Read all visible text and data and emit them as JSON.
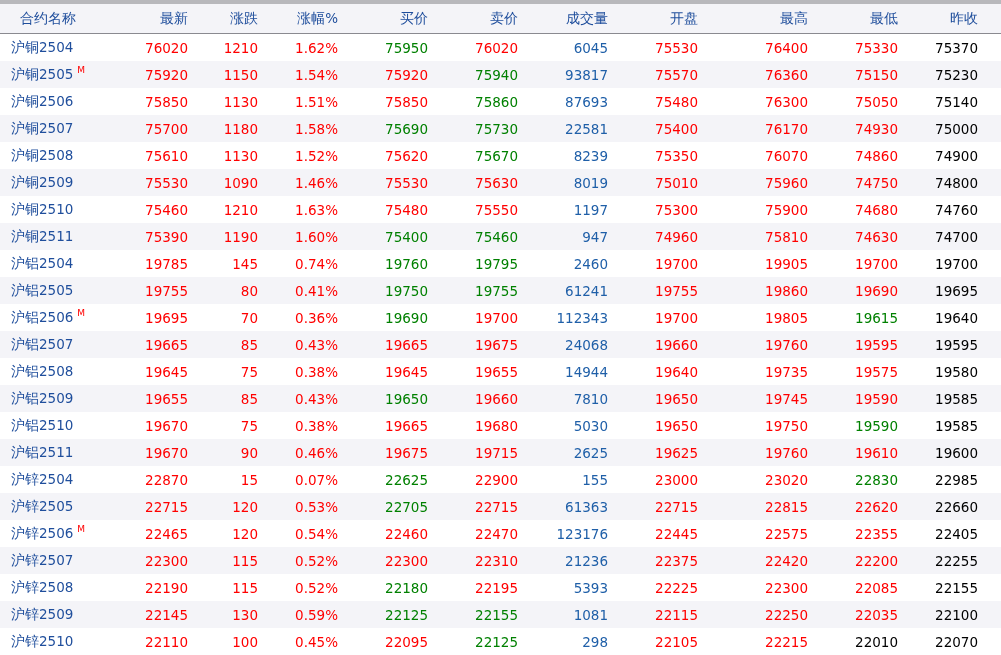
{
  "table": {
    "columns": [
      "合约名称",
      "最新",
      "涨跌",
      "涨幅%",
      "买价",
      "卖价",
      "成交量",
      "开盘",
      "最高",
      "最低",
      "昨收"
    ],
    "rows": [
      {
        "cells": [
          {
            "text": "沪铜2504",
            "color": "#1f4e9c"
          },
          {
            "text": "76020",
            "color": "#ff0000"
          },
          {
            "text": "1210",
            "color": "#ff0000"
          },
          {
            "text": "1.62%",
            "color": "#ff0000"
          },
          {
            "text": "75950",
            "color": "#008000"
          },
          {
            "text": "76020",
            "color": "#ff0000"
          },
          {
            "text": "6045",
            "color": "#1f5fa8"
          },
          {
            "text": "75530",
            "color": "#ff0000"
          },
          {
            "text": "76400",
            "color": "#ff0000"
          },
          {
            "text": "75330",
            "color": "#ff0000"
          },
          {
            "text": "75370",
            "color": "#000000"
          }
        ]
      },
      {
        "cells": [
          {
            "text": "沪铜2505",
            "marker": "M",
            "color": "#1f4e9c"
          },
          {
            "text": "75920",
            "color": "#ff0000"
          },
          {
            "text": "1150",
            "color": "#ff0000"
          },
          {
            "text": "1.54%",
            "color": "#ff0000"
          },
          {
            "text": "75920",
            "color": "#ff0000"
          },
          {
            "text": "75940",
            "color": "#008000"
          },
          {
            "text": "93817",
            "color": "#1f5fa8"
          },
          {
            "text": "75570",
            "color": "#ff0000"
          },
          {
            "text": "76360",
            "color": "#ff0000"
          },
          {
            "text": "75150",
            "color": "#ff0000"
          },
          {
            "text": "75230",
            "color": "#000000"
          }
        ]
      },
      {
        "cells": [
          {
            "text": "沪铜2506",
            "color": "#1f4e9c"
          },
          {
            "text": "75850",
            "color": "#ff0000"
          },
          {
            "text": "1130",
            "color": "#ff0000"
          },
          {
            "text": "1.51%",
            "color": "#ff0000"
          },
          {
            "text": "75850",
            "color": "#ff0000"
          },
          {
            "text": "75860",
            "color": "#008000"
          },
          {
            "text": "87693",
            "color": "#1f5fa8"
          },
          {
            "text": "75480",
            "color": "#ff0000"
          },
          {
            "text": "76300",
            "color": "#ff0000"
          },
          {
            "text": "75050",
            "color": "#ff0000"
          },
          {
            "text": "75140",
            "color": "#000000"
          }
        ]
      },
      {
        "cells": [
          {
            "text": "沪铜2507",
            "color": "#1f4e9c"
          },
          {
            "text": "75700",
            "color": "#ff0000"
          },
          {
            "text": "1180",
            "color": "#ff0000"
          },
          {
            "text": "1.58%",
            "color": "#ff0000"
          },
          {
            "text": "75690",
            "color": "#008000"
          },
          {
            "text": "75730",
            "color": "#008000"
          },
          {
            "text": "22581",
            "color": "#1f5fa8"
          },
          {
            "text": "75400",
            "color": "#ff0000"
          },
          {
            "text": "76170",
            "color": "#ff0000"
          },
          {
            "text": "74930",
            "color": "#ff0000"
          },
          {
            "text": "75000",
            "color": "#000000"
          }
        ]
      },
      {
        "cells": [
          {
            "text": "沪铜2508",
            "color": "#1f4e9c"
          },
          {
            "text": "75610",
            "color": "#ff0000"
          },
          {
            "text": "1130",
            "color": "#ff0000"
          },
          {
            "text": "1.52%",
            "color": "#ff0000"
          },
          {
            "text": "75620",
            "color": "#ff0000"
          },
          {
            "text": "75670",
            "color": "#008000"
          },
          {
            "text": "8239",
            "color": "#1f5fa8"
          },
          {
            "text": "75350",
            "color": "#ff0000"
          },
          {
            "text": "76070",
            "color": "#ff0000"
          },
          {
            "text": "74860",
            "color": "#ff0000"
          },
          {
            "text": "74900",
            "color": "#000000"
          }
        ]
      },
      {
        "cells": [
          {
            "text": "沪铜2509",
            "color": "#1f4e9c"
          },
          {
            "text": "75530",
            "color": "#ff0000"
          },
          {
            "text": "1090",
            "color": "#ff0000"
          },
          {
            "text": "1.46%",
            "color": "#ff0000"
          },
          {
            "text": "75530",
            "color": "#ff0000"
          },
          {
            "text": "75630",
            "color": "#ff0000"
          },
          {
            "text": "8019",
            "color": "#1f5fa8"
          },
          {
            "text": "75010",
            "color": "#ff0000"
          },
          {
            "text": "75960",
            "color": "#ff0000"
          },
          {
            "text": "74750",
            "color": "#ff0000"
          },
          {
            "text": "74800",
            "color": "#000000"
          }
        ]
      },
      {
        "cells": [
          {
            "text": "沪铜2510",
            "color": "#1f4e9c"
          },
          {
            "text": "75460",
            "color": "#ff0000"
          },
          {
            "text": "1210",
            "color": "#ff0000"
          },
          {
            "text": "1.63%",
            "color": "#ff0000"
          },
          {
            "text": "75480",
            "color": "#ff0000"
          },
          {
            "text": "75550",
            "color": "#ff0000"
          },
          {
            "text": "1197",
            "color": "#1f5fa8"
          },
          {
            "text": "75300",
            "color": "#ff0000"
          },
          {
            "text": "75900",
            "color": "#ff0000"
          },
          {
            "text": "74680",
            "color": "#ff0000"
          },
          {
            "text": "74760",
            "color": "#000000"
          }
        ]
      },
      {
        "cells": [
          {
            "text": "沪铜2511",
            "color": "#1f4e9c"
          },
          {
            "text": "75390",
            "color": "#ff0000"
          },
          {
            "text": "1190",
            "color": "#ff0000"
          },
          {
            "text": "1.60%",
            "color": "#ff0000"
          },
          {
            "text": "75400",
            "color": "#008000"
          },
          {
            "text": "75460",
            "color": "#008000"
          },
          {
            "text": "947",
            "color": "#1f5fa8"
          },
          {
            "text": "74960",
            "color": "#ff0000"
          },
          {
            "text": "75810",
            "color": "#ff0000"
          },
          {
            "text": "74630",
            "color": "#ff0000"
          },
          {
            "text": "74700",
            "color": "#000000"
          }
        ]
      },
      {
        "cells": [
          {
            "text": "沪铝2504",
            "color": "#1f4e9c"
          },
          {
            "text": "19785",
            "color": "#ff0000"
          },
          {
            "text": "145",
            "color": "#ff0000"
          },
          {
            "text": "0.74%",
            "color": "#ff0000"
          },
          {
            "text": "19760",
            "color": "#008000"
          },
          {
            "text": "19795",
            "color": "#008000"
          },
          {
            "text": "2460",
            "color": "#1f5fa8"
          },
          {
            "text": "19700",
            "color": "#ff0000"
          },
          {
            "text": "19905",
            "color": "#ff0000"
          },
          {
            "text": "19700",
            "color": "#ff0000"
          },
          {
            "text": "19700",
            "color": "#000000"
          }
        ]
      },
      {
        "cells": [
          {
            "text": "沪铝2505",
            "color": "#1f4e9c"
          },
          {
            "text": "19755",
            "color": "#ff0000"
          },
          {
            "text": "80",
            "color": "#ff0000"
          },
          {
            "text": "0.41%",
            "color": "#ff0000"
          },
          {
            "text": "19750",
            "color": "#008000"
          },
          {
            "text": "19755",
            "color": "#008000"
          },
          {
            "text": "61241",
            "color": "#1f5fa8"
          },
          {
            "text": "19755",
            "color": "#ff0000"
          },
          {
            "text": "19860",
            "color": "#ff0000"
          },
          {
            "text": "19690",
            "color": "#ff0000"
          },
          {
            "text": "19695",
            "color": "#000000"
          }
        ]
      },
      {
        "cells": [
          {
            "text": "沪铝2506",
            "marker": "M",
            "color": "#1f4e9c"
          },
          {
            "text": "19695",
            "color": "#ff0000"
          },
          {
            "text": "70",
            "color": "#ff0000"
          },
          {
            "text": "0.36%",
            "color": "#ff0000"
          },
          {
            "text": "19690",
            "color": "#008000"
          },
          {
            "text": "19700",
            "color": "#ff0000"
          },
          {
            "text": "112343",
            "color": "#1f5fa8"
          },
          {
            "text": "19700",
            "color": "#ff0000"
          },
          {
            "text": "19805",
            "color": "#ff0000"
          },
          {
            "text": "19615",
            "color": "#008000"
          },
          {
            "text": "19640",
            "color": "#000000"
          }
        ]
      },
      {
        "cells": [
          {
            "text": "沪铝2507",
            "color": "#1f4e9c"
          },
          {
            "text": "19665",
            "color": "#ff0000"
          },
          {
            "text": "85",
            "color": "#ff0000"
          },
          {
            "text": "0.43%",
            "color": "#ff0000"
          },
          {
            "text": "19665",
            "color": "#ff0000"
          },
          {
            "text": "19675",
            "color": "#ff0000"
          },
          {
            "text": "24068",
            "color": "#1f5fa8"
          },
          {
            "text": "19660",
            "color": "#ff0000"
          },
          {
            "text": "19760",
            "color": "#ff0000"
          },
          {
            "text": "19595",
            "color": "#ff0000"
          },
          {
            "text": "19595",
            "color": "#000000"
          }
        ]
      },
      {
        "cells": [
          {
            "text": "沪铝2508",
            "color": "#1f4e9c"
          },
          {
            "text": "19645",
            "color": "#ff0000"
          },
          {
            "text": "75",
            "color": "#ff0000"
          },
          {
            "text": "0.38%",
            "color": "#ff0000"
          },
          {
            "text": "19645",
            "color": "#ff0000"
          },
          {
            "text": "19655",
            "color": "#ff0000"
          },
          {
            "text": "14944",
            "color": "#1f5fa8"
          },
          {
            "text": "19640",
            "color": "#ff0000"
          },
          {
            "text": "19735",
            "color": "#ff0000"
          },
          {
            "text": "19575",
            "color": "#ff0000"
          },
          {
            "text": "19580",
            "color": "#000000"
          }
        ]
      },
      {
        "cells": [
          {
            "text": "沪铝2509",
            "color": "#1f4e9c"
          },
          {
            "text": "19655",
            "color": "#ff0000"
          },
          {
            "text": "85",
            "color": "#ff0000"
          },
          {
            "text": "0.43%",
            "color": "#ff0000"
          },
          {
            "text": "19650",
            "color": "#008000"
          },
          {
            "text": "19660",
            "color": "#ff0000"
          },
          {
            "text": "7810",
            "color": "#1f5fa8"
          },
          {
            "text": "19650",
            "color": "#ff0000"
          },
          {
            "text": "19745",
            "color": "#ff0000"
          },
          {
            "text": "19590",
            "color": "#ff0000"
          },
          {
            "text": "19585",
            "color": "#000000"
          }
        ]
      },
      {
        "cells": [
          {
            "text": "沪铝2510",
            "color": "#1f4e9c"
          },
          {
            "text": "19670",
            "color": "#ff0000"
          },
          {
            "text": "75",
            "color": "#ff0000"
          },
          {
            "text": "0.38%",
            "color": "#ff0000"
          },
          {
            "text": "19665",
            "color": "#ff0000"
          },
          {
            "text": "19680",
            "color": "#ff0000"
          },
          {
            "text": "5030",
            "color": "#1f5fa8"
          },
          {
            "text": "19650",
            "color": "#ff0000"
          },
          {
            "text": "19750",
            "color": "#ff0000"
          },
          {
            "text": "19590",
            "color": "#008000"
          },
          {
            "text": "19585",
            "color": "#000000"
          }
        ]
      },
      {
        "cells": [
          {
            "text": "沪铝2511",
            "color": "#1f4e9c"
          },
          {
            "text": "19670",
            "color": "#ff0000"
          },
          {
            "text": "90",
            "color": "#ff0000"
          },
          {
            "text": "0.46%",
            "color": "#ff0000"
          },
          {
            "text": "19675",
            "color": "#ff0000"
          },
          {
            "text": "19715",
            "color": "#ff0000"
          },
          {
            "text": "2625",
            "color": "#1f5fa8"
          },
          {
            "text": "19625",
            "color": "#ff0000"
          },
          {
            "text": "19760",
            "color": "#ff0000"
          },
          {
            "text": "19610",
            "color": "#ff0000"
          },
          {
            "text": "19600",
            "color": "#000000"
          }
        ]
      },
      {
        "cells": [
          {
            "text": "沪锌2504",
            "color": "#1f4e9c"
          },
          {
            "text": "22870",
            "color": "#ff0000"
          },
          {
            "text": "15",
            "color": "#ff0000"
          },
          {
            "text": "0.07%",
            "color": "#ff0000"
          },
          {
            "text": "22625",
            "color": "#008000"
          },
          {
            "text": "22900",
            "color": "#ff0000"
          },
          {
            "text": "155",
            "color": "#1f5fa8"
          },
          {
            "text": "23000",
            "color": "#ff0000"
          },
          {
            "text": "23020",
            "color": "#ff0000"
          },
          {
            "text": "22830",
            "color": "#008000"
          },
          {
            "text": "22985",
            "color": "#000000"
          }
        ]
      },
      {
        "cells": [
          {
            "text": "沪锌2505",
            "color": "#1f4e9c"
          },
          {
            "text": "22715",
            "color": "#ff0000"
          },
          {
            "text": "120",
            "color": "#ff0000"
          },
          {
            "text": "0.53%",
            "color": "#ff0000"
          },
          {
            "text": "22705",
            "color": "#008000"
          },
          {
            "text": "22715",
            "color": "#ff0000"
          },
          {
            "text": "61363",
            "color": "#1f5fa8"
          },
          {
            "text": "22715",
            "color": "#ff0000"
          },
          {
            "text": "22815",
            "color": "#ff0000"
          },
          {
            "text": "22620",
            "color": "#ff0000"
          },
          {
            "text": "22660",
            "color": "#000000"
          }
        ]
      },
      {
        "cells": [
          {
            "text": "沪锌2506",
            "marker": "M",
            "color": "#1f4e9c"
          },
          {
            "text": "22465",
            "color": "#ff0000"
          },
          {
            "text": "120",
            "color": "#ff0000"
          },
          {
            "text": "0.54%",
            "color": "#ff0000"
          },
          {
            "text": "22460",
            "color": "#ff0000"
          },
          {
            "text": "22470",
            "color": "#ff0000"
          },
          {
            "text": "123176",
            "color": "#1f5fa8"
          },
          {
            "text": "22445",
            "color": "#ff0000"
          },
          {
            "text": "22575",
            "color": "#ff0000"
          },
          {
            "text": "22355",
            "color": "#ff0000"
          },
          {
            "text": "22405",
            "color": "#000000"
          }
        ]
      },
      {
        "cells": [
          {
            "text": "沪锌2507",
            "color": "#1f4e9c"
          },
          {
            "text": "22300",
            "color": "#ff0000"
          },
          {
            "text": "115",
            "color": "#ff0000"
          },
          {
            "text": "0.52%",
            "color": "#ff0000"
          },
          {
            "text": "22300",
            "color": "#ff0000"
          },
          {
            "text": "22310",
            "color": "#ff0000"
          },
          {
            "text": "21236",
            "color": "#1f5fa8"
          },
          {
            "text": "22375",
            "color": "#ff0000"
          },
          {
            "text": "22420",
            "color": "#ff0000"
          },
          {
            "text": "22200",
            "color": "#ff0000"
          },
          {
            "text": "22255",
            "color": "#000000"
          }
        ]
      },
      {
        "cells": [
          {
            "text": "沪锌2508",
            "color": "#1f4e9c"
          },
          {
            "text": "22190",
            "color": "#ff0000"
          },
          {
            "text": "115",
            "color": "#ff0000"
          },
          {
            "text": "0.52%",
            "color": "#ff0000"
          },
          {
            "text": "22180",
            "color": "#008000"
          },
          {
            "text": "22195",
            "color": "#ff0000"
          },
          {
            "text": "5393",
            "color": "#1f5fa8"
          },
          {
            "text": "22225",
            "color": "#ff0000"
          },
          {
            "text": "22300",
            "color": "#ff0000"
          },
          {
            "text": "22085",
            "color": "#ff0000"
          },
          {
            "text": "22155",
            "color": "#000000"
          }
        ]
      },
      {
        "cells": [
          {
            "text": "沪锌2509",
            "color": "#1f4e9c"
          },
          {
            "text": "22145",
            "color": "#ff0000"
          },
          {
            "text": "130",
            "color": "#ff0000"
          },
          {
            "text": "0.59%",
            "color": "#ff0000"
          },
          {
            "text": "22125",
            "color": "#008000"
          },
          {
            "text": "22155",
            "color": "#008000"
          },
          {
            "text": "1081",
            "color": "#1f5fa8"
          },
          {
            "text": "22115",
            "color": "#ff0000"
          },
          {
            "text": "22250",
            "color": "#ff0000"
          },
          {
            "text": "22035",
            "color": "#ff0000"
          },
          {
            "text": "22100",
            "color": "#000000"
          }
        ]
      },
      {
        "cells": [
          {
            "text": "沪锌2510",
            "color": "#1f4e9c"
          },
          {
            "text": "22110",
            "color": "#ff0000"
          },
          {
            "text": "100",
            "color": "#ff0000"
          },
          {
            "text": "0.45%",
            "color": "#ff0000"
          },
          {
            "text": "22095",
            "color": "#ff0000"
          },
          {
            "text": "22125",
            "color": "#008000"
          },
          {
            "text": "298",
            "color": "#1f5fa8"
          },
          {
            "text": "22105",
            "color": "#ff0000"
          },
          {
            "text": "22215",
            "color": "#ff0000"
          },
          {
            "text": "22010",
            "color": "#000000"
          },
          {
            "text": "22070",
            "color": "#000000"
          }
        ]
      }
    ]
  }
}
